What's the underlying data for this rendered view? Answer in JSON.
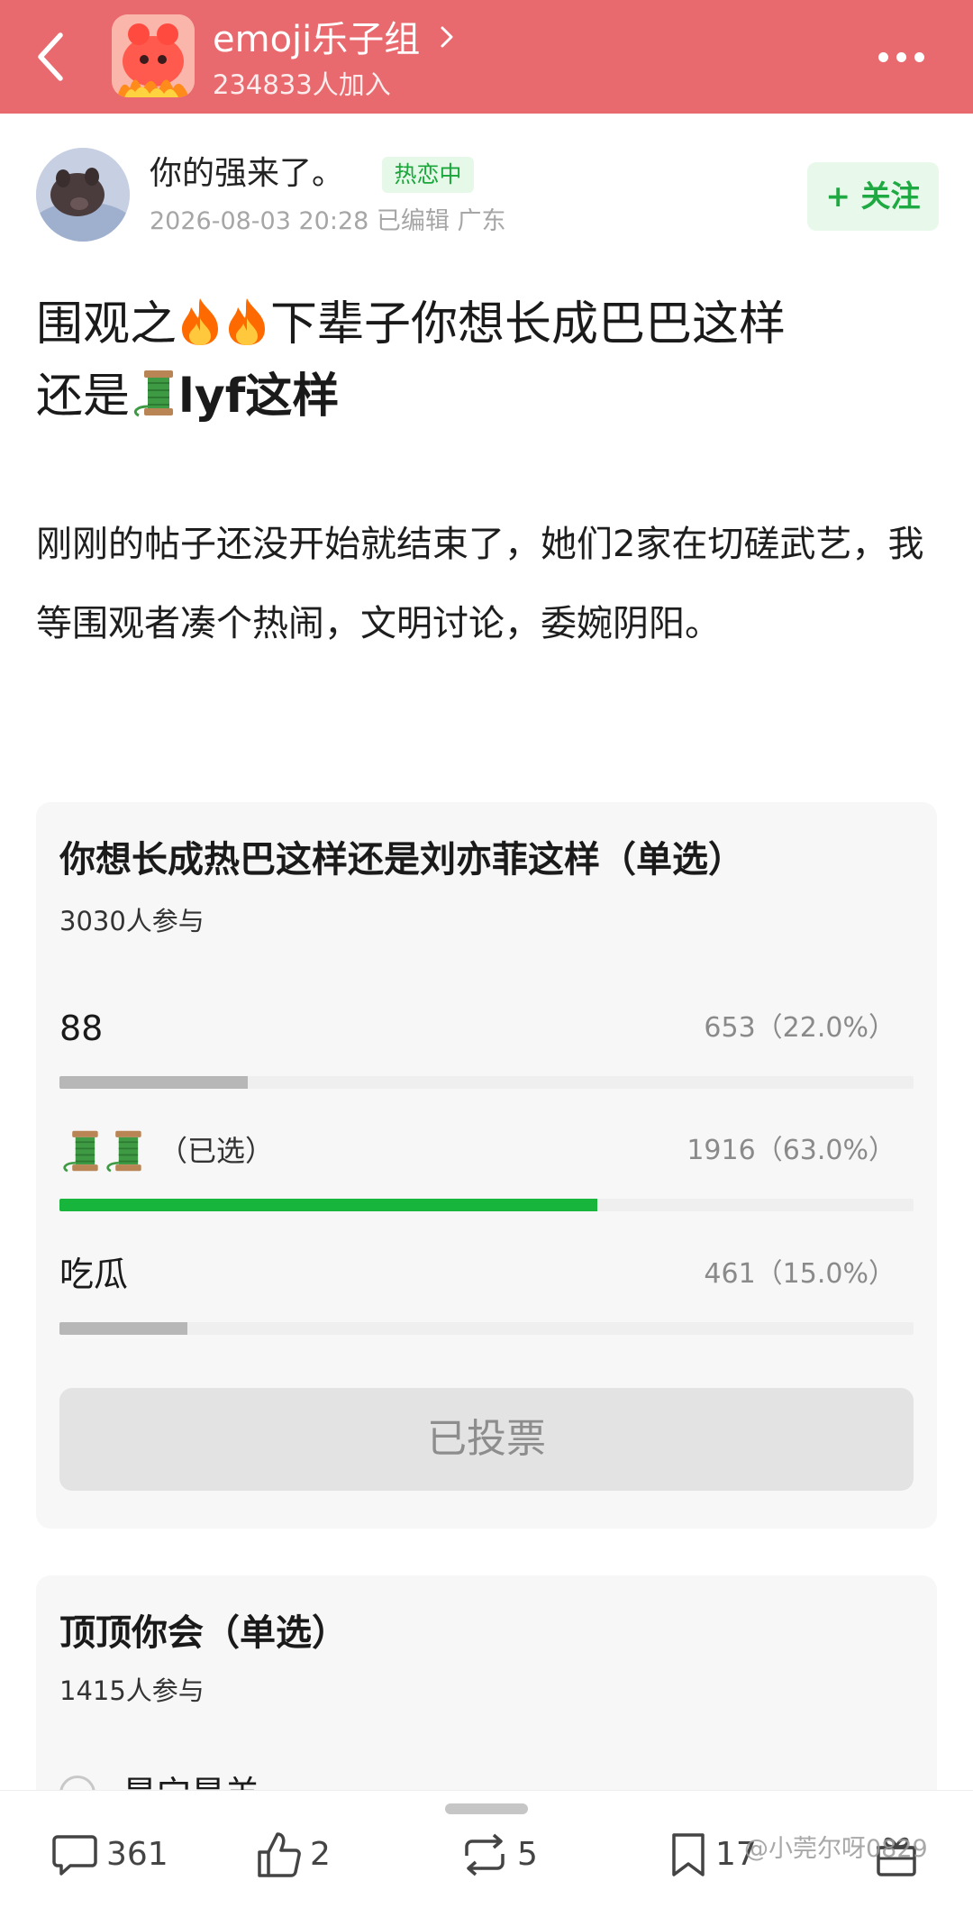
{
  "header": {
    "group_name": "emoji乐子组",
    "member_count": "234833人加入",
    "accent_color": "#e86a6e"
  },
  "author": {
    "name": "你的强来了。",
    "badge": "热恋中",
    "meta": "2026-08-03 20:28  已编辑  广东",
    "follow_label": "+ 关注"
  },
  "post": {
    "title_part1": "围观之",
    "title_part2": "下辈子你想长成巴巴这样",
    "title_part3": "还是",
    "title_part4": "lyf这样",
    "body": "刚刚的帖子还没开始就结束了，她们2家在切磋武艺，我等围观者凑个热闹，文明讨论，委婉阴阳。"
  },
  "poll1": {
    "title": "你想长成热巴这样还是刘亦菲这样（单选）",
    "participants": "3030人参与",
    "options": [
      {
        "label": "88",
        "result": "653（22.0%）",
        "fraction": 0.22,
        "selected": false
      },
      {
        "label": "",
        "selected_text": "（已选）",
        "result": "1916（63.0%）",
        "fraction": 0.63,
        "selected": true
      },
      {
        "label": "吃瓜",
        "result": "461（15.0%）",
        "fraction": 0.15,
        "selected": false
      }
    ],
    "voted_label": "已投票",
    "selected_color": "#17b53c"
  },
  "poll2": {
    "title": "顶顶你会（单选）",
    "participants": "1415人参与",
    "first_option_partial": "㝵宀㝵羊"
  },
  "bottom_bar": {
    "comments": "361",
    "likes": "2",
    "reposts": "5",
    "bookmarks": "17"
  },
  "watermark": "@小莞尔呀0829",
  "icons": [
    "back-arrow-icon",
    "chevron-right-icon",
    "more-icon",
    "fire-icon",
    "thread-spool-icon",
    "comment-icon",
    "like-icon",
    "repost-icon",
    "bookmark-icon",
    "gift-icon"
  ]
}
